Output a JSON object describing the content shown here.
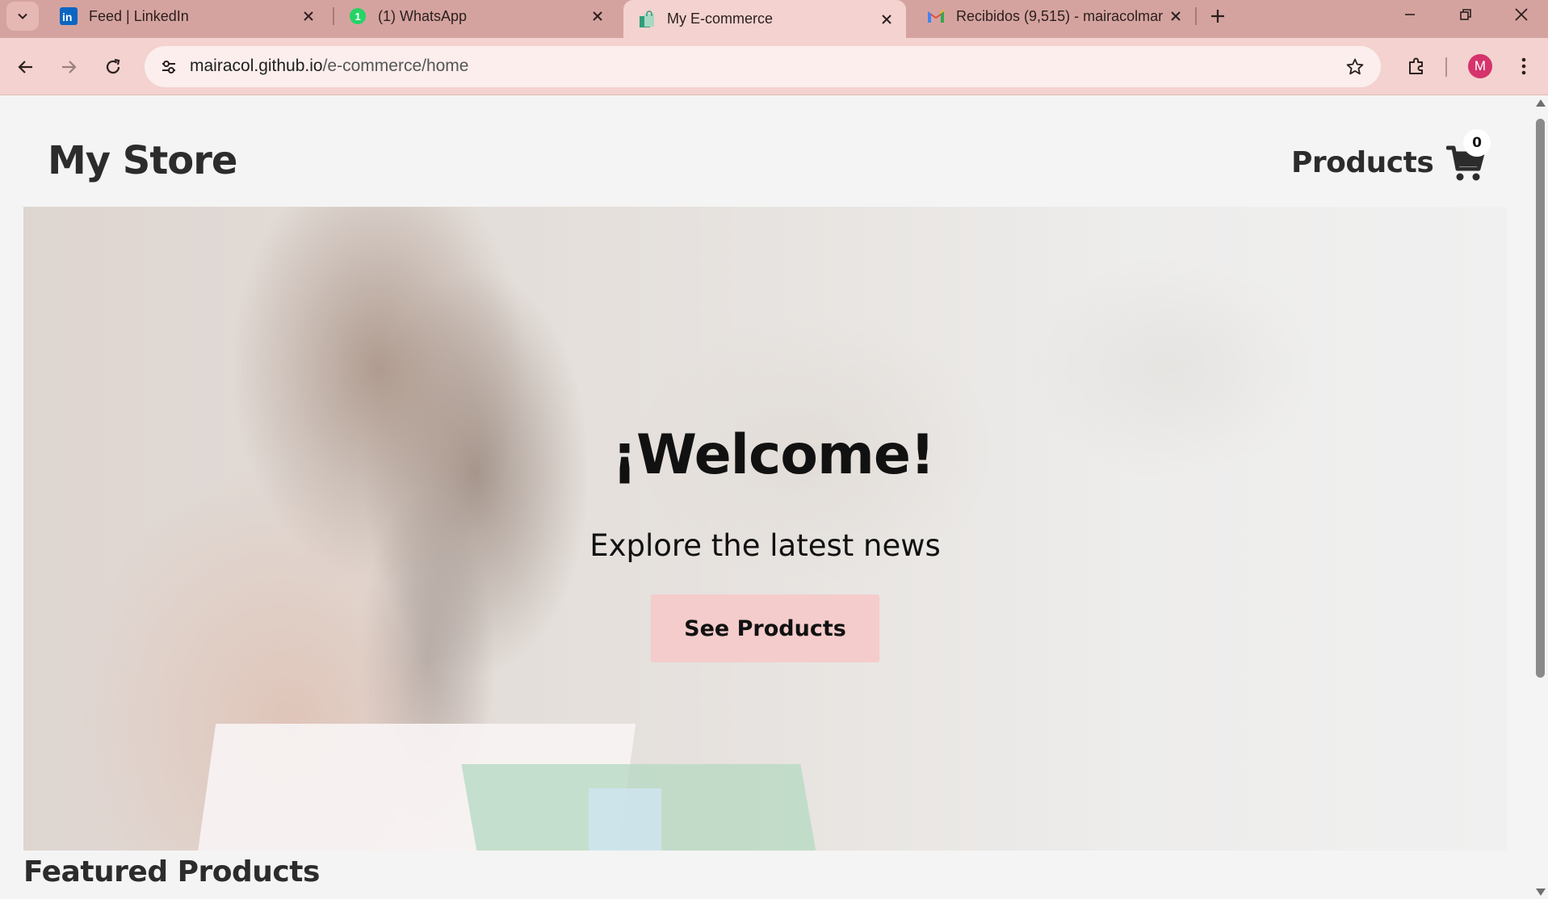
{
  "browser": {
    "tabs": [
      {
        "title": "Feed | LinkedIn",
        "icon": "linkedin-icon",
        "active": false
      },
      {
        "title": "(1) WhatsApp",
        "icon": "whatsapp-icon",
        "badge": "1",
        "active": false
      },
      {
        "title": "My E-commerce",
        "icon": "shopping-bag-icon",
        "active": true
      },
      {
        "title": "Recibidos (9,515) - mairacolmar",
        "icon": "gmail-icon",
        "active": false
      }
    ],
    "url_host": "mairacol.github.io",
    "url_path": "/e-commerce/home",
    "profile_initial": "M",
    "colors": {
      "tabbar": "#d5a39f",
      "toolbar": "#f3d2cf",
      "avatar": "#d6336c"
    }
  },
  "site": {
    "logo": "My Store",
    "nav_products": "Products",
    "cart_count": "0"
  },
  "hero": {
    "title": "¡Welcome!",
    "subtitle": "Explore the latest news",
    "cta": "See Products",
    "cta_color": "#f4cccb"
  },
  "featured": {
    "title": "Featured Products"
  }
}
